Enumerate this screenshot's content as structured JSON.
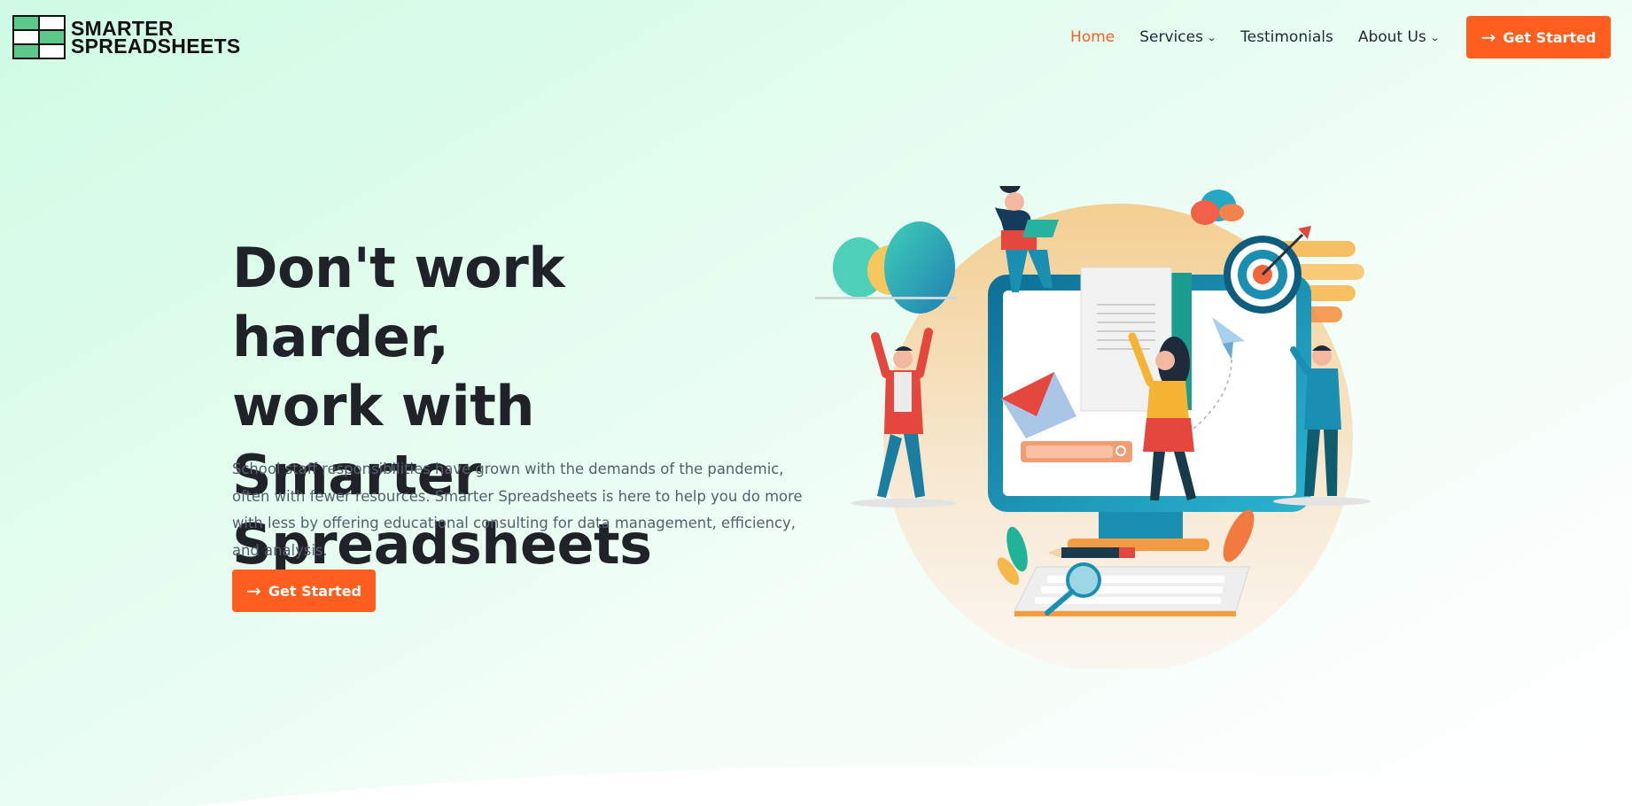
{
  "brand": {
    "name_line1": "SMARTER",
    "name_line2": "SPREADSHEETS",
    "colors": {
      "green": "#5cc98a",
      "white": "#ffffff"
    }
  },
  "nav": {
    "items": [
      {
        "label": "Home",
        "active": true,
        "dropdown": false
      },
      {
        "label": "Services",
        "active": false,
        "dropdown": true
      },
      {
        "label": "Testimonials",
        "active": false,
        "dropdown": false
      },
      {
        "label": "About Us",
        "active": false,
        "dropdown": true
      }
    ],
    "chevron_glyph": "⌄",
    "cta_label": "Get Started",
    "cta_icon": "arrow-right-icon"
  },
  "hero": {
    "title_line1": "Don't work harder,",
    "title_line2": "work with Smarter",
    "title_line3": "Spreadsheets",
    "description": "School staff responsibilities have grown with the demands of the pandemic, often with fewer resources. Smarter Spreadsheets is here to help you do more with less by offering educational consulting for data management, efficiency, and analysis.",
    "cta_label": "Get Started",
    "cta_icon": "arrow-right-icon"
  },
  "theme": {
    "accent": "#ff5e1f",
    "text_dark": "#1f2327",
    "text_muted": "#555f6b"
  }
}
